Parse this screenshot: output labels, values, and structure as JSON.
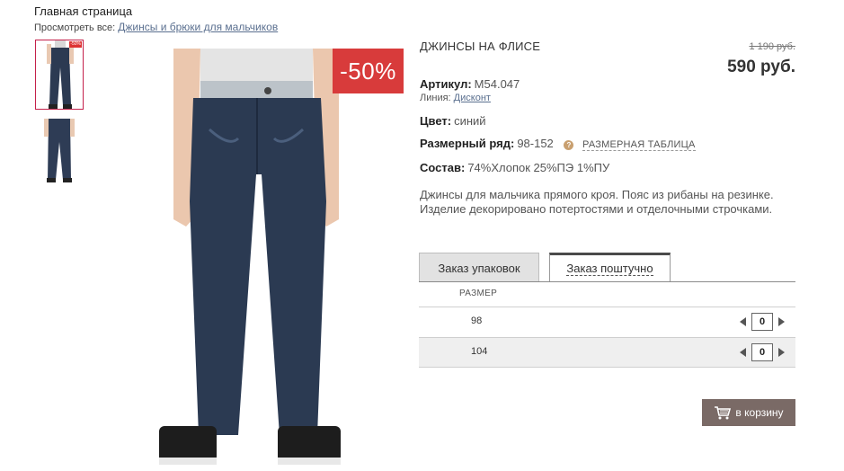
{
  "breadcrumb": {
    "home": "Главная страница",
    "view_all_label": "Просмотреть все:",
    "view_all_link": "Джинсы и брюки для мальчиков"
  },
  "gallery": {
    "thumb_badge": "-50%",
    "discount_badge": "-50%"
  },
  "product": {
    "title": "ДЖИНСЫ НА ФЛИСЕ",
    "old_price": "1 190 руб.",
    "new_price": "590 руб.",
    "article_label": "Артикул:",
    "article_value": "M54.047",
    "line_label": "Линия:",
    "line_value": "Дисконт",
    "color_label": "Цвет:",
    "color_value": "синий",
    "size_range_label": "Размерный ряд:",
    "size_range_value": "98-152",
    "size_table_link": "РАЗМЕРНАЯ ТАБЛИЦА",
    "help_glyph": "?",
    "composition_label": "Состав:",
    "composition_value": "74%Хлопок 25%ПЭ 1%ПУ",
    "description": "Джинсы для мальчика прямого кроя. Пояс из рибаны на резинке. Изделие декорировано потертостями и отделочными строчками."
  },
  "order": {
    "tab_packages": "Заказ упаковок",
    "tab_single": "Заказ поштучно",
    "size_header": "РАЗМЕР",
    "rows": [
      {
        "size": "98",
        "qty": "0"
      },
      {
        "size": "104",
        "qty": "0"
      }
    ],
    "add_to_cart": "в корзину"
  },
  "colors": {
    "accent_red": "#d83b3b",
    "cart_button": "#7a6a66",
    "link": "#5a6f8f"
  }
}
